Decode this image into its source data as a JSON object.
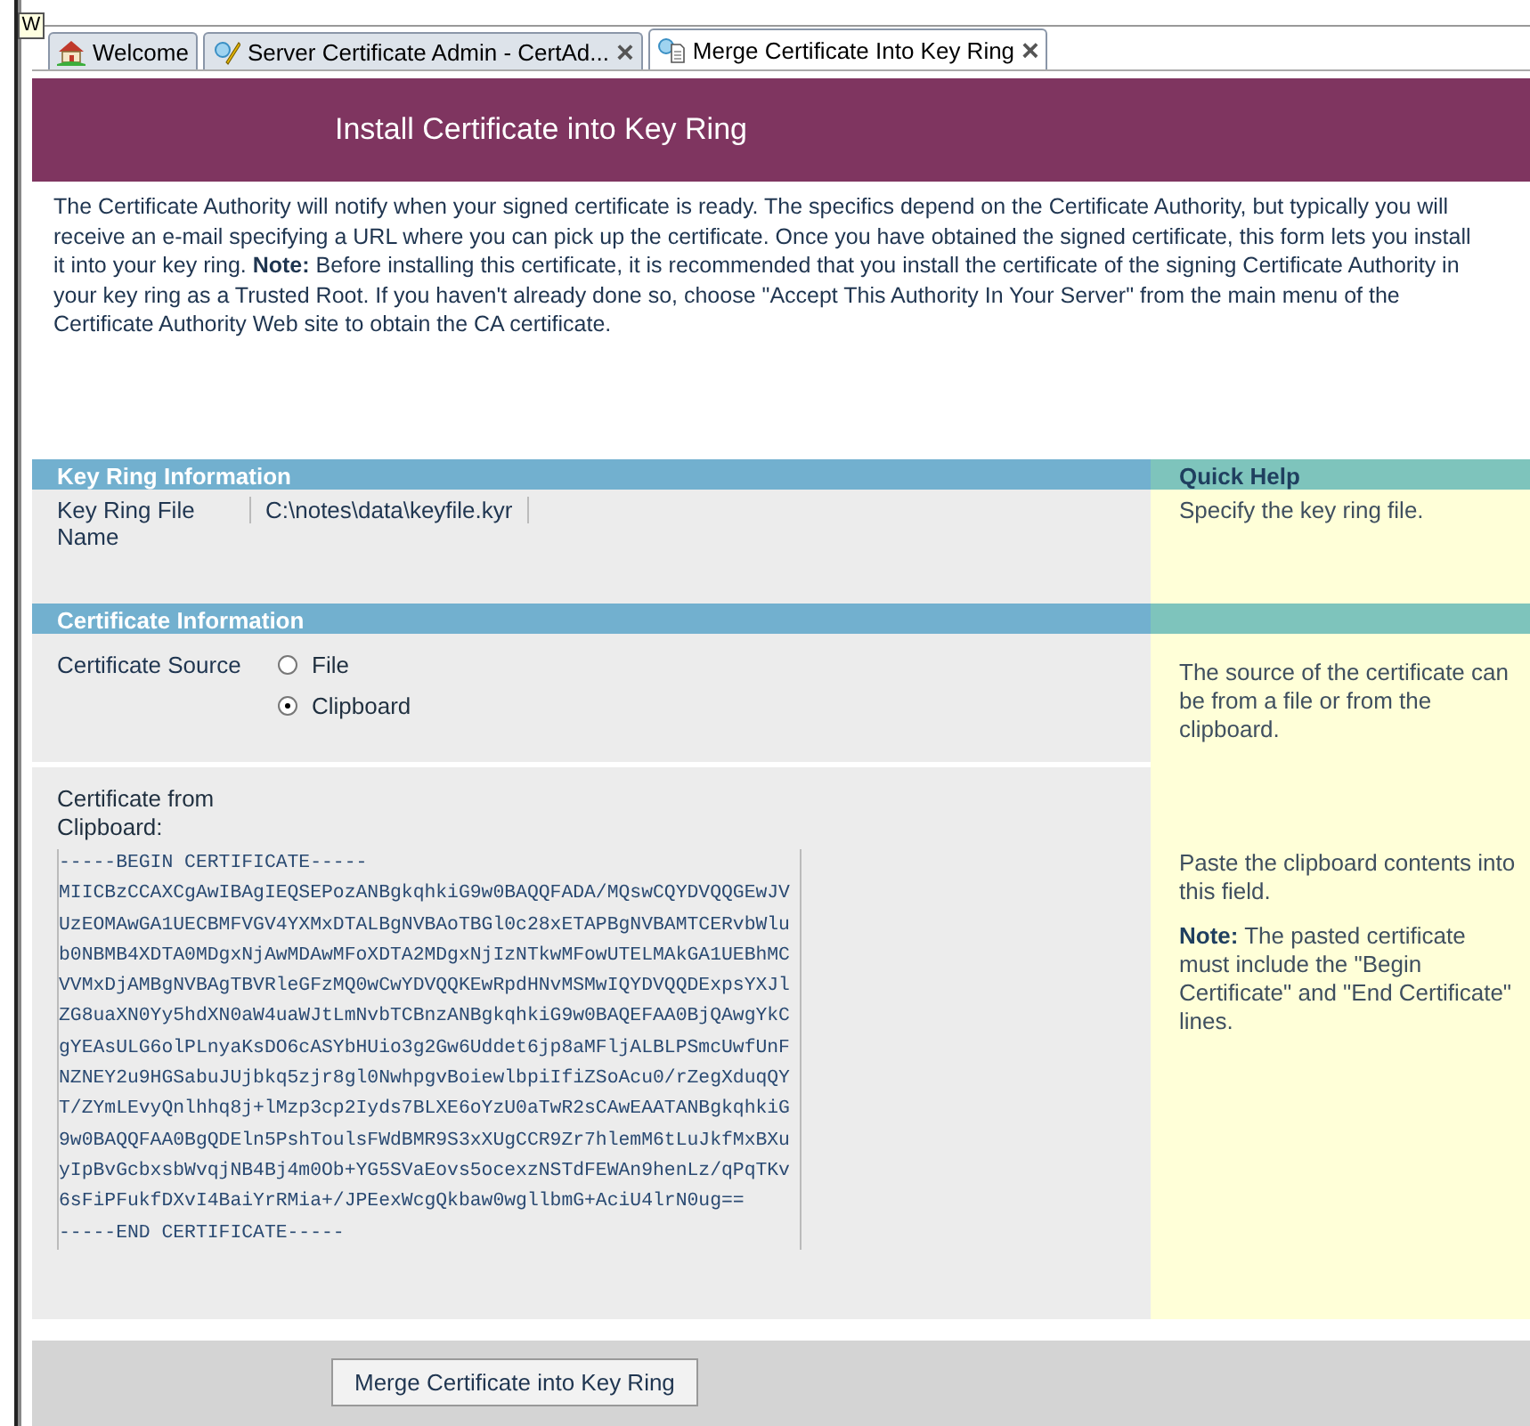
{
  "app_badge": "W",
  "tabs": [
    {
      "label": "Welcome",
      "kind": "home",
      "selected": false
    },
    {
      "label": "Server Certificate Admin - CertAd...",
      "kind": "admin",
      "selected": false,
      "close": "×"
    },
    {
      "label": "Merge Certificate Into Key Ring",
      "kind": "form",
      "selected": true,
      "close": "×"
    }
  ],
  "header": {
    "title": "Install Certificate into Key Ring"
  },
  "intro": "The Certificate Authority will notify when your signed certificate is ready. The specifics depend on the Certificate Authority, but typically you will receive an e-mail specifying a URL where you can pick up the certificate. Once you have obtained the signed certificate, this form lets you install it into your key ring.  **Note:** Before installing this certificate, it is recommended that you install the certificate of the signing Certificate Authority in your key ring as a Trusted Root.  If you haven't already done so, choose \"Accept This Authority In Your Server\" from the main menu of the Certificate Authority Web site to obtain the CA certificate.",
  "sections": [
    {
      "title": "Key Ring Information",
      "help_title": "Quick Help",
      "rows": [
        {
          "kind": "text",
          "label": "Key Ring File Name",
          "value": "C:\\notes\\data\\keyfile.kyr",
          "help": [
            "Specify the key ring file."
          ]
        }
      ]
    },
    {
      "title": "Certificate Information",
      "rows": [
        {
          "kind": "radio",
          "label": "Certificate Source",
          "options": [
            {
              "label": "File",
              "selected": false
            },
            {
              "label": "Clipboard",
              "selected": true
            }
          ],
          "help": [
            "The source of the certificate can be from a file or from the clipboard."
          ]
        },
        {
          "kind": "textarea",
          "label": "Certificate from Clipboard:",
          "lines": [
            "-----BEGIN CERTIFICATE-----",
            "MIICBzCCAXCgAwIBAgIEQSEPozANBgkqhkiG9w0BAQQFADA/MQswCQYDVQQGEwJV",
            "UzEOMAwGA1UECBMFVGV4YXMxDTALBgNVBAoTBGl0c28xETAPBgNVBAMTCERvbWlu",
            "b0NBMB4XDTA0MDgxNjAwMDAwMFoXDTA2MDgxNjIzNTkwMFowUTELMAkGA1UEBhMC",
            "VVMxDjAMBgNVBAgTBVRleGFzMQ0wCwYDVQQKEwRpdHNvMSMwIQYDVQQDExpsYXJl",
            "ZG8uaXN0Yy5hdXN0aW4uaWJtLmNvbTCBnzANBgkqhkiG9w0BAQEFAA0BjQAwgYkC",
            "gYEAsULG6olPLnyaKsDO6cASYbHUio3g2Gw6Uddet6jp8aMFljALBLPSmcUwfUnF",
            "NZNEY2u9HGSabuJUjbkq5zjr8gl0NwhpgvBoiewlbpiIfiZSoAcu0/rZegXduqQY",
            "T/ZYmLEvyQnlhhq8j+lMzp3cp2Iyds7BLXE6oYzU0aTwR2sCAwEAATANBgkqhkiG",
            "9w0BAQQFAA0BgQDEln5PshToulsFWdBMR9S3xXUgCCR9Zr7hlemM6tLuJkfMxBXu",
            "yIpBvGcbxsbWvqjNB4Bj4m0Ob+YG5SVaEovs5ocexzNSTdFEWAn9henLz/qPqTKv",
            "6sFiPFukfDXvI4BaiYrRMia+/JPEexWcgQkbaw0wgllbmG+AciU4lrN0ug==",
            "-----END CERTIFICATE-----"
          ],
          "help": [
            "Paste the clipboard contents into this field.",
            "**Note:** The pasted certificate must include the \"Begin Certificate\" and \"End Certificate\" lines."
          ]
        }
      ]
    }
  ],
  "submit": "Merge Certificate into Key Ring"
}
